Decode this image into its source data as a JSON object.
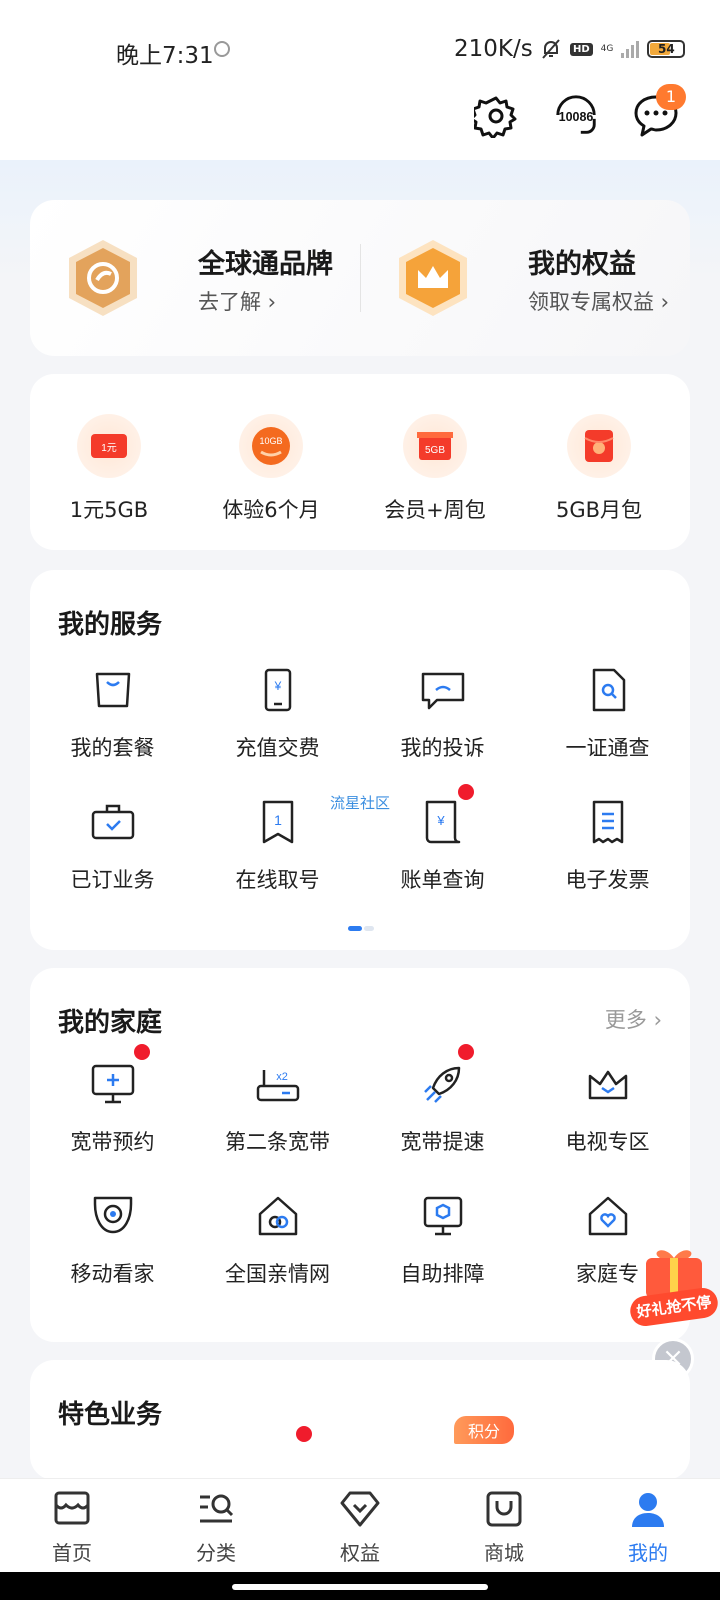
{
  "status_bar": {
    "time": "晚上7:31",
    "speed": "210K/s",
    "hd": "HD",
    "network": "4G",
    "battery": "54"
  },
  "header": {
    "settings_icon": "gear-icon",
    "hotline_label": "10086",
    "message_badge": "1"
  },
  "brand": {
    "left_title": "全球通品牌",
    "left_sub": "去了解 ›",
    "right_title": "我的权益",
    "right_sub": "领取专属权益 ›"
  },
  "promos": [
    {
      "label": "1元5GB",
      "icon_text": "1元"
    },
    {
      "label": "体验6个月",
      "icon_text": "10GB"
    },
    {
      "label": "会员+周包",
      "icon_text": "5GB"
    },
    {
      "label": "5GB月包",
      "icon_text": ""
    }
  ],
  "services": {
    "title": "我的服务",
    "watermark": "流星社区",
    "items": [
      {
        "label": "我的套餐"
      },
      {
        "label": "充值交费"
      },
      {
        "label": "我的投诉"
      },
      {
        "label": "一证通查"
      },
      {
        "label": "已订业务"
      },
      {
        "label": "在线取号"
      },
      {
        "label": "账单查询"
      },
      {
        "label": "电子发票"
      }
    ]
  },
  "family": {
    "title": "我的家庭",
    "more": "更多 ›",
    "items": [
      {
        "label": "宽带预约"
      },
      {
        "label": "第二条宽带"
      },
      {
        "label": "宽带提速"
      },
      {
        "label": "电视专区"
      },
      {
        "label": "移动看家"
      },
      {
        "label": "全国亲情网"
      },
      {
        "label": "自助排障"
      },
      {
        "label": "家庭专"
      }
    ]
  },
  "special": {
    "title": "特色业务",
    "points_tag": "积分"
  },
  "float_gift": {
    "text": "好礼抢不停"
  },
  "tabs": [
    {
      "label": "首页"
    },
    {
      "label": "分类"
    },
    {
      "label": "权益"
    },
    {
      "label": "商城"
    },
    {
      "label": "我的"
    }
  ],
  "colors": {
    "accent": "#2c7bf0",
    "badge": "#ff7a2f",
    "red_dot": "#f01c2c"
  }
}
